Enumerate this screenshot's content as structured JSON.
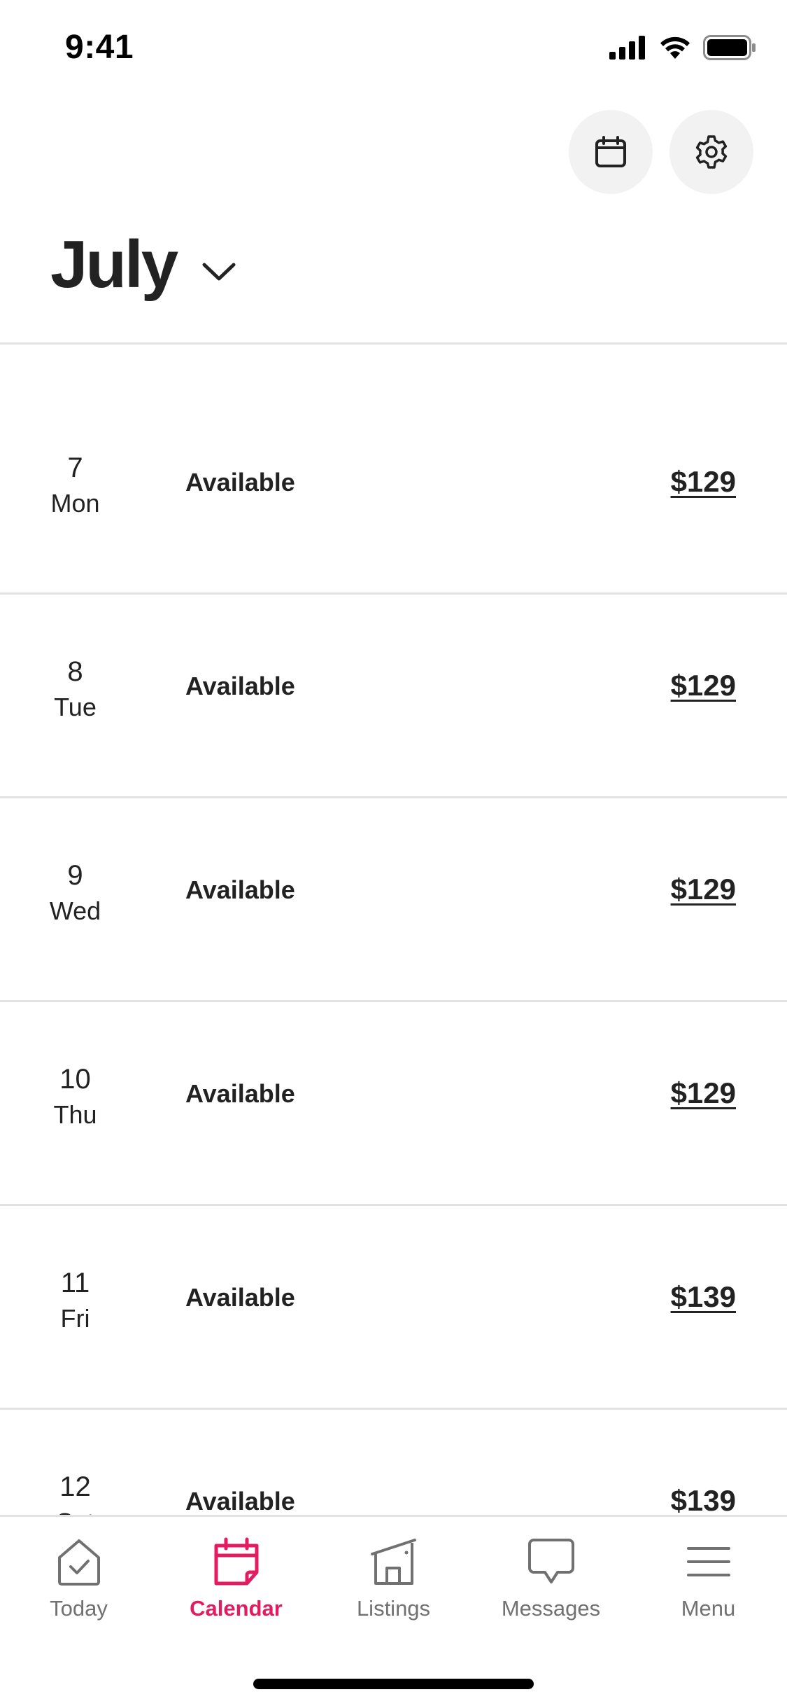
{
  "status_bar": {
    "time": "9:41"
  },
  "header": {
    "calendar_icon": "calendar-icon",
    "settings_icon": "gear-icon",
    "month": "July"
  },
  "days": [
    {
      "day": "7",
      "weekday": "Mon",
      "status": "Available",
      "price": "$129"
    },
    {
      "day": "8",
      "weekday": "Tue",
      "status": "Available",
      "price": "$129"
    },
    {
      "day": "9",
      "weekday": "Wed",
      "status": "Available",
      "price": "$129"
    },
    {
      "day": "10",
      "weekday": "Thu",
      "status": "Available",
      "price": "$129"
    },
    {
      "day": "11",
      "weekday": "Fri",
      "status": "Available",
      "price": "$139"
    },
    {
      "day": "12",
      "weekday": "Sat",
      "status": "Available",
      "price": "$139"
    }
  ],
  "tabs": [
    {
      "label": "Today",
      "icon": "home-check-icon",
      "active": false
    },
    {
      "label": "Calendar",
      "icon": "calendar-icon",
      "active": true
    },
    {
      "label": "Listings",
      "icon": "building-icon",
      "active": false
    },
    {
      "label": "Messages",
      "icon": "chat-bubble-icon",
      "active": false
    },
    {
      "label": "Menu",
      "icon": "menu-icon",
      "active": false
    }
  ],
  "colors": {
    "accent": "#E31C5F",
    "text": "#222222",
    "muted": "#717171",
    "divider": "#E2E2E2",
    "button_bg": "#F2F2F2"
  }
}
